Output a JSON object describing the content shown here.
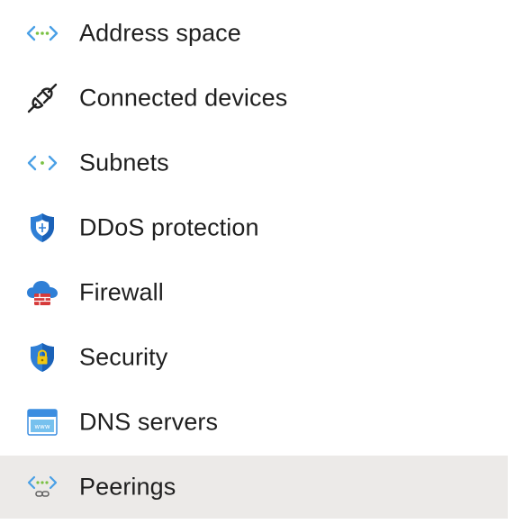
{
  "menu": {
    "items": [
      {
        "label": "Address space",
        "icon": "address-space-icon"
      },
      {
        "label": "Connected devices",
        "icon": "plug-icon"
      },
      {
        "label": "Subnets",
        "icon": "subnets-icon"
      },
      {
        "label": "DDoS protection",
        "icon": "ddos-shield-icon"
      },
      {
        "label": "Firewall",
        "icon": "firewall-cloud-icon"
      },
      {
        "label": "Security",
        "icon": "security-shield-lock-icon"
      },
      {
        "label": "DNS servers",
        "icon": "dns-servers-icon"
      },
      {
        "label": "Peerings",
        "icon": "peerings-icon",
        "selected": true
      }
    ]
  },
  "colors": {
    "selected_background": "#eceae8",
    "text": "#1f1f1f",
    "azure_blue": "#3b8de0",
    "teal": "#5ab6c9",
    "firewall_red": "#d63a3a",
    "lock_gold": "#f2c811"
  }
}
